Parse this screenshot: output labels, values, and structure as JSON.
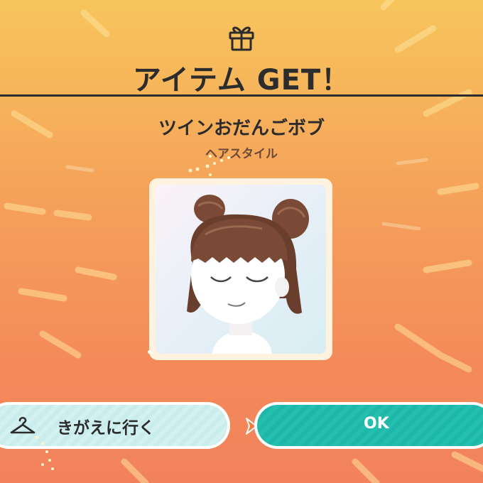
{
  "header": {
    "icon": "gift-box-icon",
    "title": "アイテム GET！"
  },
  "item": {
    "name": "ツインおだんごボブ",
    "category": "ヘアスタイル"
  },
  "actions": {
    "dressup_label": "きがえに行く",
    "dressup_icon": "hanger-icon",
    "ok_label": "OK",
    "cursor_icon": "chevron-right-icon"
  },
  "colors": {
    "background_top": "#f7c55c",
    "background_bottom": "#f2825c",
    "ok_button": "#1fb7a8",
    "dressup_button": "#c9ecec",
    "text": "#2c2c2c"
  }
}
